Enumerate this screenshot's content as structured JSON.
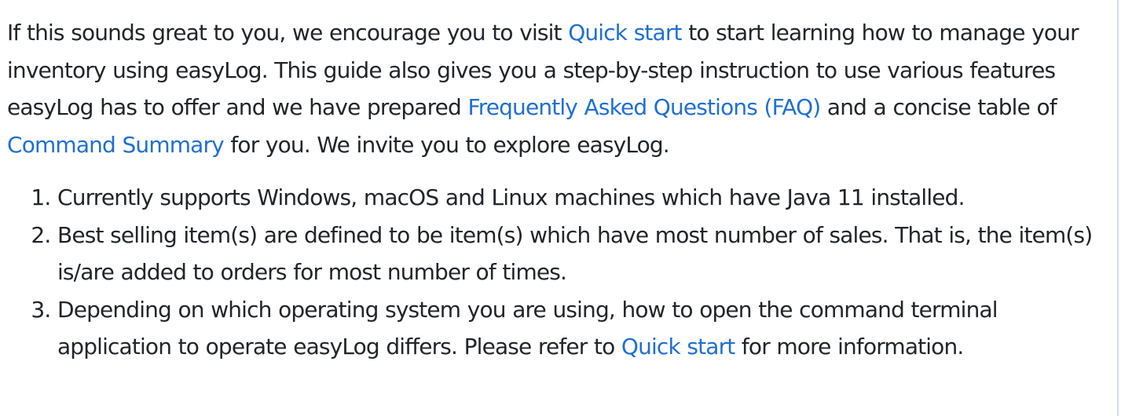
{
  "intro": {
    "t1": "If this sounds great to you, we encourage you to visit ",
    "link_quick_start": "Quick start",
    "t2": " to start learning how to manage your inventory using easyLog. This guide also gives you a step-by-step instruction to use various features easyLog has to offer and we have prepared ",
    "link_faq": "Frequently Asked Questions (FAQ)",
    "t3": " and a concise table of ",
    "link_command_summary": "Command Summary",
    "t4": " for you. We invite you to explore easyLog."
  },
  "notes": {
    "item1": "Currently supports Windows, macOS and Linux machines which have Java 11 installed.",
    "item2": "Best selling item(s) are defined to be item(s) which have most number of sales. That is, the item(s) is/are added to orders for most number of times.",
    "item3_pre": "Depending on which operating system you are using, how to open the command terminal application to operate easyLog differs. Please refer to ",
    "item3_link": "Quick start",
    "item3_post": " for more information."
  },
  "colors": {
    "text": "#212529",
    "link": "#1f6fd1",
    "rule": "#cfdcec"
  }
}
